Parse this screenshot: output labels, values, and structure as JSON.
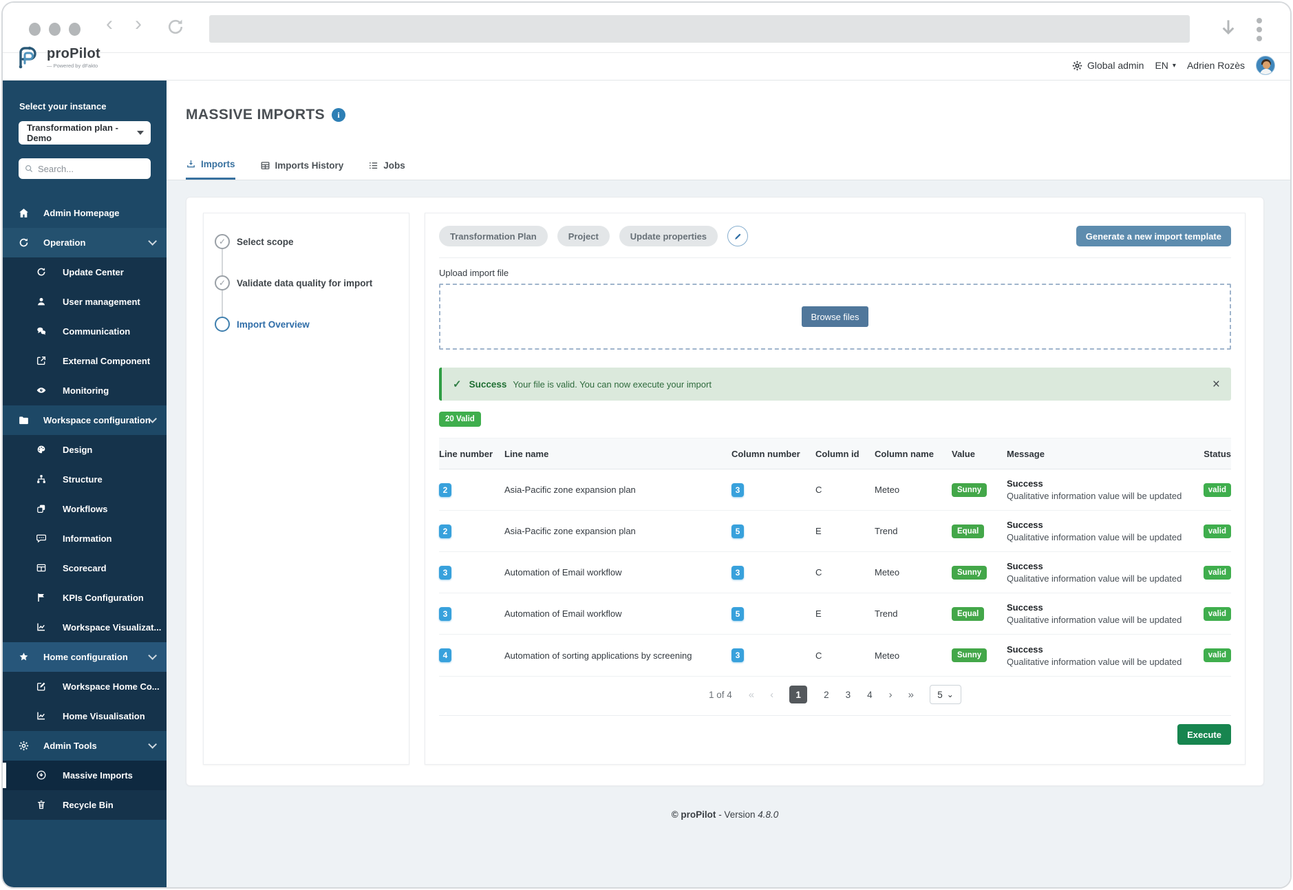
{
  "header": {
    "brand": "proPilot",
    "brand_tagline": "— Powered by dFakto",
    "role_label": "Global admin",
    "language": "EN",
    "user_name": "Adrien Rozès"
  },
  "sidebar": {
    "instance_label": "Select your instance",
    "instance_value": "Transformation plan - Demo",
    "search_placeholder": "Search...",
    "items": [
      {
        "label": "Admin Homepage"
      },
      {
        "label": "Operation"
      },
      {
        "label": "Update Center"
      },
      {
        "label": "User management"
      },
      {
        "label": "Communication"
      },
      {
        "label": "External Component"
      },
      {
        "label": "Monitoring"
      },
      {
        "label": "Workspace configuration"
      },
      {
        "label": "Design"
      },
      {
        "label": "Structure"
      },
      {
        "label": "Workflows"
      },
      {
        "label": "Information"
      },
      {
        "label": "Scorecard"
      },
      {
        "label": "KPIs Configuration"
      },
      {
        "label": "Workspace Visualizat..."
      },
      {
        "label": "Home configuration"
      },
      {
        "label": "Workspace Home Co..."
      },
      {
        "label": "Home Visualisation"
      },
      {
        "label": "Admin Tools"
      },
      {
        "label": "Massive Imports"
      },
      {
        "label": "Recycle Bin"
      }
    ]
  },
  "page": {
    "title": "MASSIVE IMPORTS",
    "tabs": [
      {
        "label": "Imports"
      },
      {
        "label": "Imports History"
      },
      {
        "label": "Jobs"
      }
    ]
  },
  "stepper": {
    "steps": [
      {
        "label": "Select scope"
      },
      {
        "label": "Validate data quality for import"
      },
      {
        "label": "Import Overview"
      }
    ]
  },
  "scope": {
    "badges": [
      {
        "label": "Transformation Plan"
      },
      {
        "label": "Project"
      },
      {
        "label": "Update properties"
      }
    ],
    "generate_button": "Generate a new import template"
  },
  "upload": {
    "label": "Upload import file",
    "browse_button": "Browse files"
  },
  "alert": {
    "title": "Success",
    "message": "Your file is valid. You can now execute your import"
  },
  "summary": {
    "valid_badge": "20 Valid"
  },
  "table": {
    "headers": [
      "Line number",
      "Line name",
      "Column number",
      "Column id",
      "Column name",
      "Value",
      "Message",
      "Status"
    ],
    "rows": [
      {
        "line_number": "2",
        "line_name": "Asia-Pacific zone expansion plan",
        "column_number": "3",
        "column_id": "C",
        "column_name": "Meteo",
        "value": "Sunny",
        "message_title": "Success",
        "message_detail": "Qualitative information value will be updated",
        "status": "valid"
      },
      {
        "line_number": "2",
        "line_name": "Asia-Pacific zone expansion plan",
        "column_number": "5",
        "column_id": "E",
        "column_name": "Trend",
        "value": "Equal",
        "message_title": "Success",
        "message_detail": "Qualitative information value will be updated",
        "status": "valid"
      },
      {
        "line_number": "3",
        "line_name": "Automation of Email workflow",
        "column_number": "3",
        "column_id": "C",
        "column_name": "Meteo",
        "value": "Sunny",
        "message_title": "Success",
        "message_detail": "Qualitative information value will be updated",
        "status": "valid"
      },
      {
        "line_number": "3",
        "line_name": "Automation of Email workflow",
        "column_number": "5",
        "column_id": "E",
        "column_name": "Trend",
        "value": "Equal",
        "message_title": "Success",
        "message_detail": "Qualitative information value will be updated",
        "status": "valid"
      },
      {
        "line_number": "4",
        "line_name": "Automation of sorting applications by screening",
        "column_number": "3",
        "column_id": "C",
        "column_name": "Meteo",
        "value": "Sunny",
        "message_title": "Success",
        "message_detail": "Qualitative information value will be updated",
        "status": "valid"
      }
    ]
  },
  "pagination": {
    "summary": "1 of 4",
    "pages": [
      "1",
      "2",
      "3",
      "4"
    ],
    "active_page": "1",
    "page_size": "5"
  },
  "actions": {
    "execute_button": "Execute"
  },
  "footer": {
    "copyright": "© proPilot",
    "version_label": " - Version ",
    "version": "4.8.0"
  },
  "icons": {
    "info": "i",
    "check": "✓",
    "close": "×",
    "back": "‹",
    "forward": "›",
    "first_page": "«",
    "prev_page": "‹",
    "next_page": "›",
    "last_page": "»",
    "caret_down": "⌄",
    "lang_caret": "▾"
  },
  "colors": {
    "sidebar_navy": "#1d4866",
    "sidebar_sub": "#15334b",
    "accent_blue": "#38719f",
    "steel_button": "#5d8cae",
    "success_green": "#3fae4d",
    "execute_green": "#17854f",
    "badge_blue": "#38a1dc",
    "alert_bg": "#dbe9dc"
  }
}
